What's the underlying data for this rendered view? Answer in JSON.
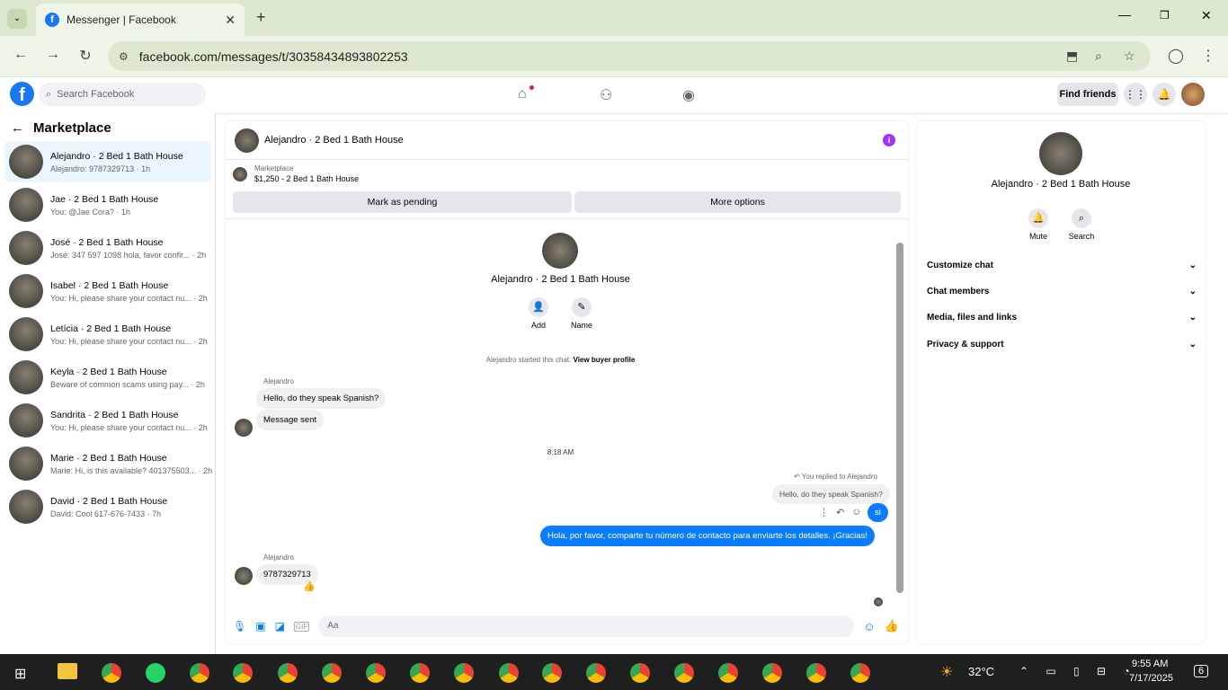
{
  "browser": {
    "tab_title": "Messenger | Facebook",
    "url": "facebook.com/messages/t/30358434893802253"
  },
  "header": {
    "search_placeholder": "Search Facebook",
    "find_friends": "Find friends"
  },
  "left": {
    "title": "Marketplace",
    "conversations": [
      {
        "name": "Alejandro · 2 Bed 1 Bath House",
        "preview": "Alejandro: 9787329713 · 1h"
      },
      {
        "name": "Jae · 2 Bed 1 Bath House",
        "preview": "You: @Jae Cora? · 1h"
      },
      {
        "name": "José · 2 Bed 1 Bath House",
        "preview": "José: 347 597 1098 hola, favor confir... · 2h"
      },
      {
        "name": "Isabel · 2 Bed 1 Bath House",
        "preview": "You: Hi, please share your contact nu... · 2h"
      },
      {
        "name": "Letícia · 2 Bed 1 Bath House",
        "preview": "You: Hi, please share your contact nu... · 2h"
      },
      {
        "name": "Keyla · 2 Bed 1 Bath House",
        "preview": "Beware of common scams using pay... · 2h"
      },
      {
        "name": "Sandrita · 2 Bed 1 Bath House",
        "preview": "You: Hi, please share your contact nu... · 2h"
      },
      {
        "name": "Marie · 2 Bed 1 Bath House",
        "preview": "Marie: Hi, is this available? 401375503... · 2h"
      },
      {
        "name": "David · 2 Bed 1 Bath House",
        "preview": "David: Cool 617-676-7433 · 7h"
      }
    ]
  },
  "chat": {
    "title": "Alejandro · 2 Bed 1 Bath House",
    "market_label": "Marketplace",
    "listing": "$1,250 - 2 Bed 1 Bath House",
    "pending": "Mark as pending",
    "more": "More options",
    "profile_name": "Alejandro · 2 Bed 1 Bath House",
    "add": "Add",
    "name_btn": "Name",
    "started": "Alejandro started this chat.",
    "view_profile": "View buyer profile",
    "sender": "Alejandro",
    "m1": "Hello, do they speak Spanish?",
    "m2": "Message sent",
    "time": "8:18 AM",
    "replied": "You replied to Alejandro",
    "quoted": "Hello, do they speak Spanish?",
    "si": "si",
    "long": "Hola, por favor, comparte tu número de contacto para enviarte los detalles. ¡Gracias!",
    "sender2": "Alejandro",
    "m3": "9787329713",
    "composer": "Aa"
  },
  "right": {
    "name": "Alejandro · 2 Bed 1 Bath House",
    "mute": "Mute",
    "search": "Search",
    "sections": [
      "Customize chat",
      "Chat members",
      "Media, files and links",
      "Privacy & support"
    ]
  },
  "taskbar": {
    "temp": "32°C",
    "time": "9:55 AM",
    "date": "7/17/2025",
    "notif": "6"
  }
}
